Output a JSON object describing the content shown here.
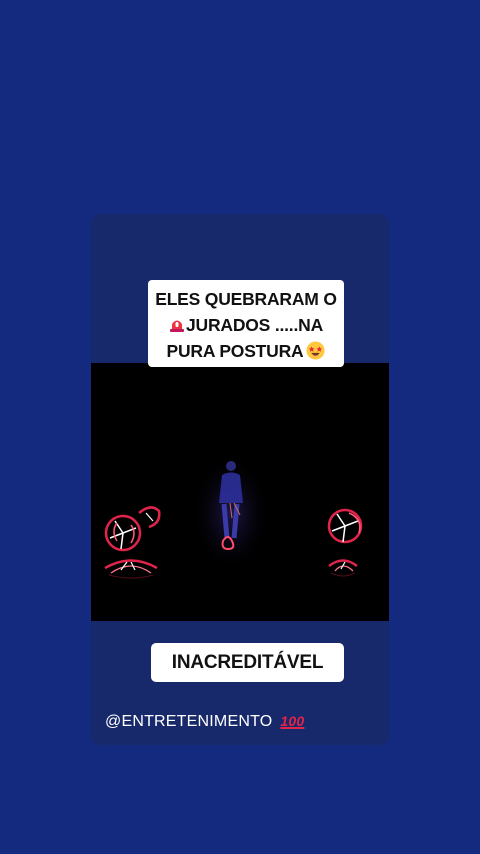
{
  "story": {
    "caption_top": {
      "line1": "ELES QUEBRARAM O",
      "line2_emoji": "alarm-light-emoji",
      "line2": "JURADOS .....NA",
      "line3": "PURA POSTURA",
      "line3_emoji": "star-struck-emoji"
    },
    "caption_bottom": "INACREDITÁVEL",
    "handle": "@ENTRETENIMENTO",
    "handle_emoji": "100"
  },
  "colors": {
    "background": "#142a7f",
    "card": "#17296a",
    "video_bg": "#000000",
    "caption_bg": "#ffffff",
    "neon_red": "#e0244a"
  }
}
